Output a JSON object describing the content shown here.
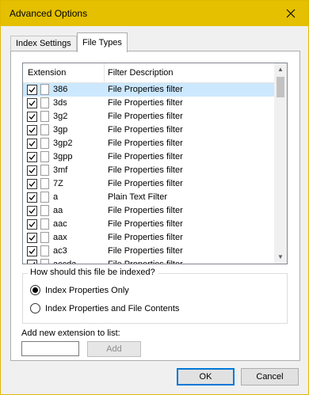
{
  "window": {
    "title": "Advanced Options"
  },
  "tabs": [
    {
      "label": "Index Settings",
      "active": false
    },
    {
      "label": "File Types",
      "active": true
    }
  ],
  "list": {
    "columns": {
      "extension": "Extension",
      "description": "Filter Description"
    },
    "rows": [
      {
        "ext": "386",
        "desc": "File Properties filter",
        "checked": true,
        "selected": true
      },
      {
        "ext": "3ds",
        "desc": "File Properties filter",
        "checked": true
      },
      {
        "ext": "3g2",
        "desc": "File Properties filter",
        "checked": true
      },
      {
        "ext": "3gp",
        "desc": "File Properties filter",
        "checked": true
      },
      {
        "ext": "3gp2",
        "desc": "File Properties filter",
        "checked": true
      },
      {
        "ext": "3gpp",
        "desc": "File Properties filter",
        "checked": true
      },
      {
        "ext": "3mf",
        "desc": "File Properties filter",
        "checked": true
      },
      {
        "ext": "7Z",
        "desc": "File Properties filter",
        "checked": true
      },
      {
        "ext": "a",
        "desc": "Plain Text Filter",
        "checked": true
      },
      {
        "ext": "aa",
        "desc": "File Properties filter",
        "checked": true
      },
      {
        "ext": "aac",
        "desc": "File Properties filter",
        "checked": true
      },
      {
        "ext": "aax",
        "desc": "File Properties filter",
        "checked": true
      },
      {
        "ext": "ac3",
        "desc": "File Properties filter",
        "checked": true
      },
      {
        "ext": "accda",
        "desc": "File Properties filter",
        "checked": true
      }
    ]
  },
  "index_group": {
    "title": "How should this file be indexed?",
    "options": [
      {
        "label": "Index Properties Only",
        "selected": true
      },
      {
        "label": "Index Properties and File Contents",
        "selected": false
      }
    ]
  },
  "add_extension": {
    "label": "Add new extension to list:",
    "value": "",
    "button": "Add"
  },
  "buttons": {
    "ok": "OK",
    "cancel": "Cancel"
  },
  "colors": {
    "title_bar": "#e4c000",
    "selection": "#cce8ff"
  }
}
